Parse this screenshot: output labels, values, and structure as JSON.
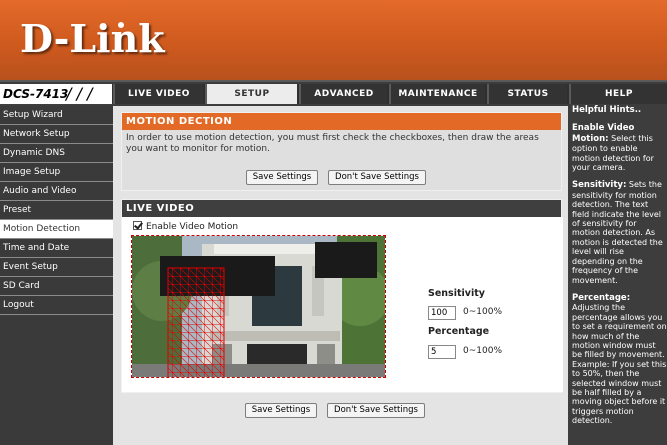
{
  "brand": {
    "logo": "D-Link"
  },
  "model": "DCS-7413",
  "tabs": [
    {
      "label": "LIVE VIDEO",
      "active": false
    },
    {
      "label": "SETUP",
      "active": true
    },
    {
      "label": "ADVANCED",
      "active": false
    },
    {
      "label": "MAINTENANCE",
      "active": false
    },
    {
      "label": "STATUS",
      "active": false
    },
    {
      "label": "HELP",
      "active": false
    }
  ],
  "sidebar": {
    "items": [
      {
        "label": "Setup Wizard",
        "active": false
      },
      {
        "label": "Network Setup",
        "active": false
      },
      {
        "label": "Dynamic DNS",
        "active": false
      },
      {
        "label": "Image Setup",
        "active": false
      },
      {
        "label": "Audio and Video",
        "active": false
      },
      {
        "label": "Preset",
        "active": false
      },
      {
        "label": "Motion Detection",
        "active": true
      },
      {
        "label": "Time and Date",
        "active": false
      },
      {
        "label": "Event Setup",
        "active": false
      },
      {
        "label": "SD Card",
        "active": false
      },
      {
        "label": "Logout",
        "active": false
      }
    ]
  },
  "motion_section": {
    "title": "MOTION DECTION",
    "intro": "In order to use motion detection, you must first check the checkboxes, then draw the areas you want to monitor for motion.",
    "save_label": "Save Settings",
    "dont_save_label": "Don't Save Settings"
  },
  "live_section": {
    "title": "LIVE VIDEO",
    "enable_label": "Enable Video Motion",
    "enable_checked": true,
    "sensitivity_label": "Sensitivity",
    "sensitivity_value": "100",
    "sensitivity_range": "0~100%",
    "percentage_label": "Percentage",
    "percentage_value": "5",
    "percentage_range": "0~100%"
  },
  "bottom_buttons": {
    "save_label": "Save Settings",
    "dont_save_label": "Don't Save Settings"
  },
  "help": {
    "title": "Helpful Hints..",
    "enable_head": "Enable Video Motion:",
    "enable_text": " Select this option to enable motion detection for your camera.",
    "sensitivity_head": "Sensitivity:",
    "sensitivity_text": " Sets the sensitivity for motion detection. The text field indicate the level of sensitivity for motion detection. As motion is detected the level will rise depending on the frequency of the movement.",
    "percentage_head": "Percentage:",
    "percentage_text": " Adjusting the percentage allows you to set a requirement on how much of the motion window must be filled by movement. Example: If you set this to 50%, then the selected window must be half filled by a moving object before it triggers motion detection."
  },
  "colors": {
    "header_orange": "#e36a2a",
    "section_orange": "#e26a26",
    "dark_bg": "#3d3d3d",
    "motion_grid": "#e60000"
  }
}
